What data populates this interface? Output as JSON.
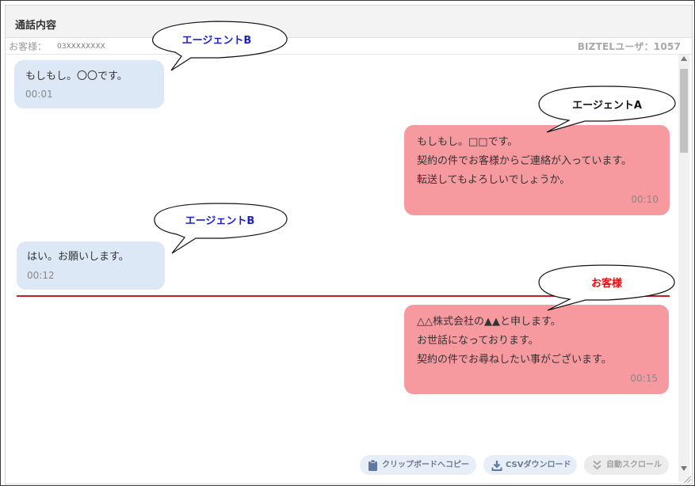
{
  "panel": {
    "title": "通話内容",
    "customer_label": "お客様：",
    "customer_number": "03XXXXXXXX",
    "user_label": "BIZTELユーザ：1057"
  },
  "messages": [
    {
      "side": "left",
      "lines": [
        "もしもし。〇〇です。"
      ],
      "time": "00:01"
    },
    {
      "side": "right",
      "lines": [
        "もしもし。□□です。",
        "契約の件でお客様からご連絡が入っています。",
        "転送してもよろしいでしょうか。"
      ],
      "time": "00:10"
    },
    {
      "side": "left",
      "lines": [
        "はい。お願いします。"
      ],
      "time": "00:12"
    },
    {
      "side": "right",
      "lines": [
        "△△株式会社の▲▲と申します。",
        "お世話になっております。",
        "契約の件でお尋ねしたい事がございます。"
      ],
      "time": "00:15"
    }
  ],
  "callouts": [
    {
      "label": "エージェントB",
      "color": "#1a22cc"
    },
    {
      "label": "エージェントA",
      "color": "#111111"
    },
    {
      "label": "エージェントB",
      "color": "#1a22cc"
    },
    {
      "label": "お客様",
      "color": "#e01010"
    }
  ],
  "buttons": {
    "copy": "クリップボードへコピー",
    "csv": "CSVダウンロード",
    "autoscroll": "自動スクロール"
  },
  "icons": {
    "copy": "clipboard-icon",
    "csv": "download-icon",
    "autoscroll": "double-chevron-down-icon"
  }
}
